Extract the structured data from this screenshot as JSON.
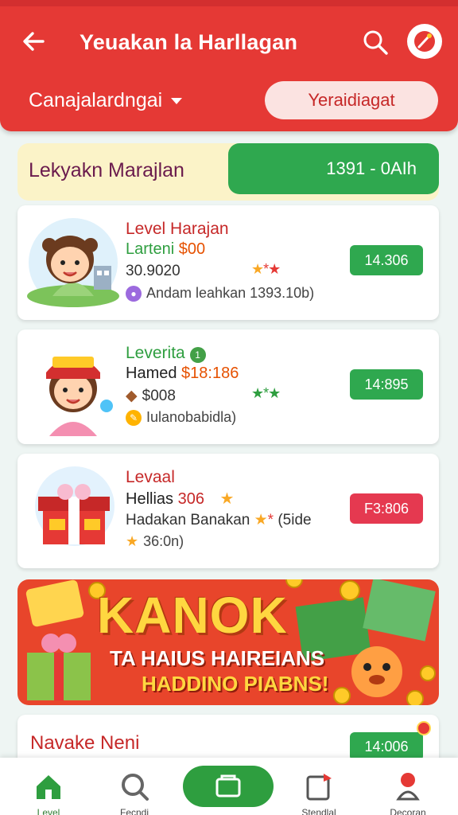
{
  "header": {
    "title": "Yeuakan la Harllagan",
    "dropdown_label": "Canajalardngai",
    "pill_button": "Yeraidiagat"
  },
  "promo_strip": {
    "left_text": "Lekyakn Marajlan",
    "right_text": "1391 - 0AIh"
  },
  "cards": [
    {
      "line1": "Level Harajan",
      "line2_a": "Larteni ",
      "line2_b": "$00",
      "line3": "30.9020",
      "line4": "Andam leahkan 1393.10b)",
      "price": "14.306"
    },
    {
      "line1": "Leverita",
      "line2_a": "Hamed ",
      "line2_b": "$18:186",
      "line3": "$008",
      "line4": "Iulanobabidla)",
      "price": "14:895"
    },
    {
      "line1": "Levaal",
      "line2_a": "Hellias ",
      "line2_b": "306",
      "line3": "Hadakan Banakan",
      "line3_tail": "(5ide",
      "line4": "36:0n)",
      "price": "F3:806"
    }
  ],
  "big_banner": {
    "title": "KANOK",
    "subtitle1": "TA HAIUS HAIREIANS",
    "subtitle2": "HADDINO PIABNS!"
  },
  "peek_card": {
    "title": "Navake Neni",
    "price": "14:006"
  },
  "bottom_nav": {
    "items": [
      {
        "label": "Level"
      },
      {
        "label": "Fecndi"
      },
      {
        "label": ""
      },
      {
        "label": "Stendlal"
      },
      {
        "label": "Decoran"
      }
    ]
  },
  "colors": {
    "header_red": "#e53935",
    "accent_green": "#2fa84f",
    "price_red": "#e53950"
  }
}
